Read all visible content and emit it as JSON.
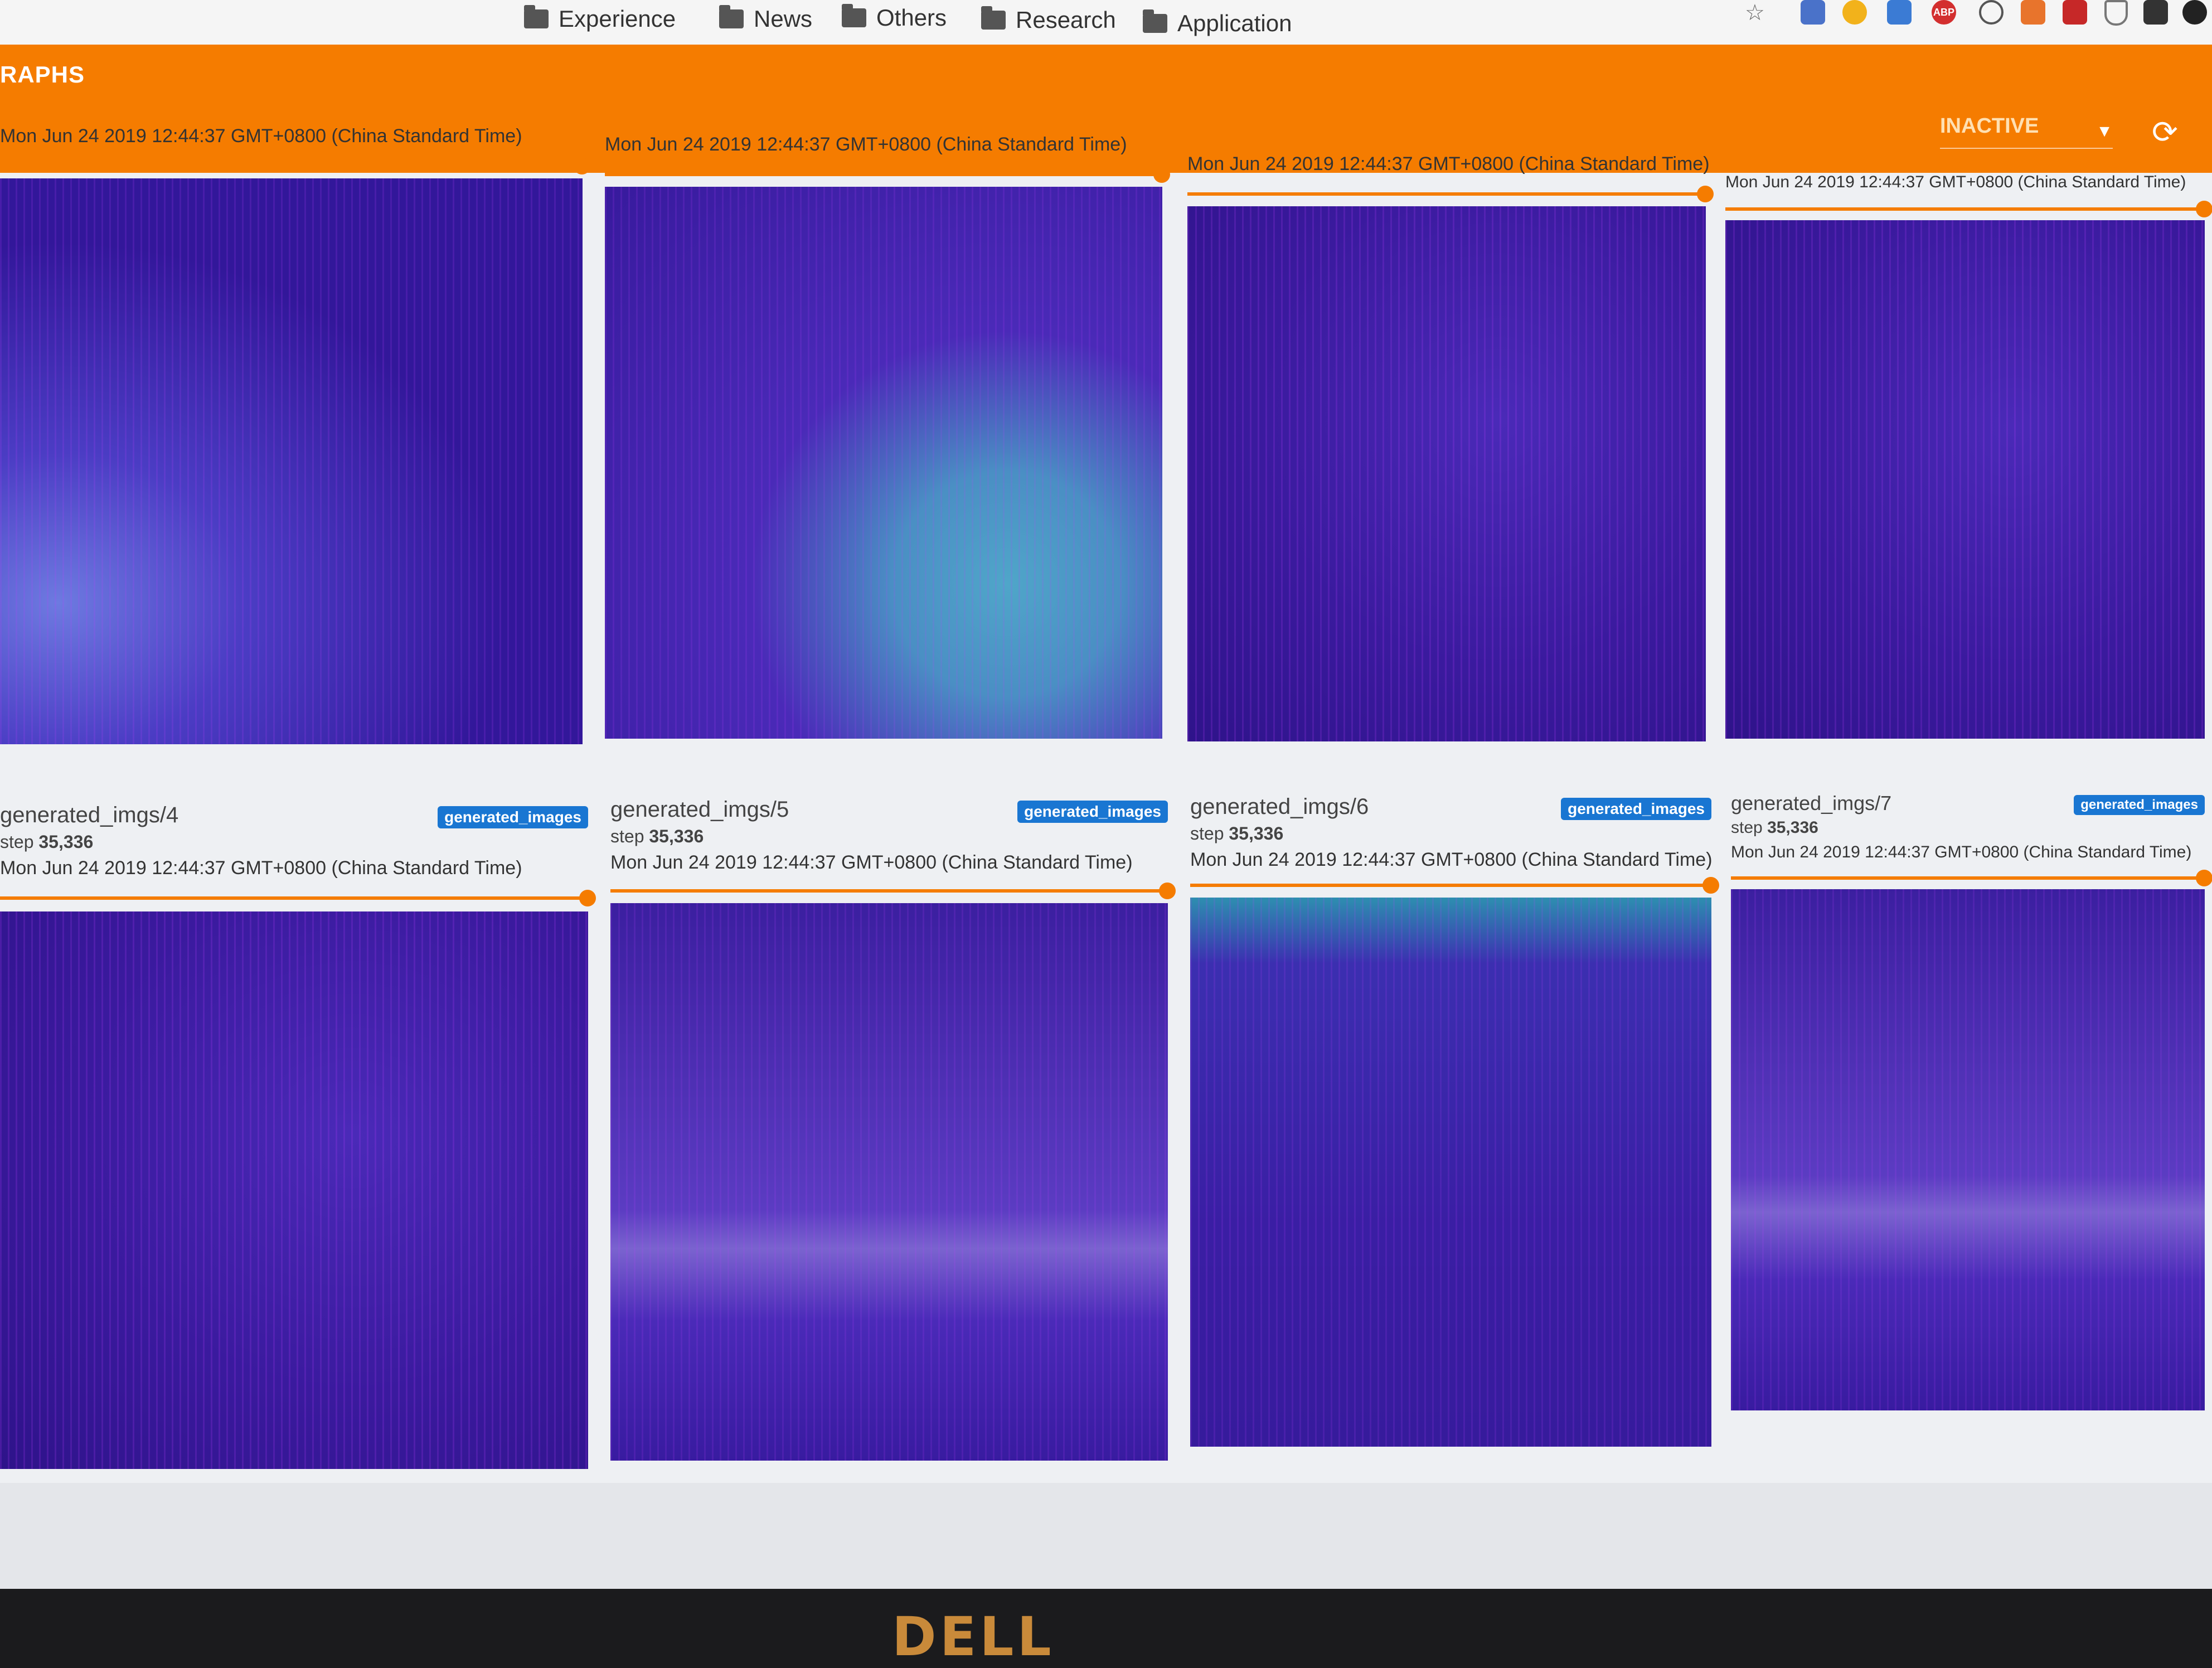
{
  "bookmarks": {
    "items": [
      {
        "label": "Experience",
        "icon": "folder-icon"
      },
      {
        "label": "News",
        "icon": "folder-icon"
      },
      {
        "label": "Others",
        "icon": "folder-icon"
      },
      {
        "label": "Research",
        "icon": "folder-icon"
      },
      {
        "label": "Application",
        "icon": "folder-icon"
      }
    ],
    "extensions": [
      {
        "icon": "star-icon"
      },
      {
        "icon": "extension-blue-icon"
      },
      {
        "icon": "chrome-icon"
      },
      {
        "icon": "dashboard-icon"
      },
      {
        "icon": "adblock-icon",
        "label": "ABP"
      },
      {
        "icon": "speedometer-icon"
      },
      {
        "icon": "fox-icon"
      },
      {
        "icon": "zotero-icon"
      },
      {
        "icon": "shield-icon"
      },
      {
        "icon": "puzzle-icon"
      },
      {
        "icon": "github-icon"
      }
    ]
  },
  "toolbar": {
    "title": "RAPHS",
    "run_select": {
      "value": "INACTIVE"
    },
    "refresh_icon": "refresh-icon",
    "color": "#f57c00"
  },
  "cards_top": [
    {
      "timestamp": "Mon Jun 24 2019 12:44:37 GMT+0800 (China Standard Time)"
    },
    {
      "timestamp": "Mon Jun 24 2019 12:44:37 GMT+0800 (China Standard Time)"
    },
    {
      "timestamp": "Mon Jun 24 2019 12:44:37 GMT+0800 (China Standard Time)"
    },
    {
      "timestamp": "Mon Jun 24 2019 12:44:37 GMT+0800 (China Standard Time)"
    }
  ],
  "cards_bottom": [
    {
      "name": "generated_imgs/4",
      "step_label": "step",
      "step": "35,336",
      "tag": "generated_images",
      "timestamp": "Mon Jun 24 2019 12:44:37 GMT+0800 (China Standard Time)"
    },
    {
      "name": "generated_imgs/5",
      "step_label": "step",
      "step": "35,336",
      "tag": "generated_images",
      "timestamp": "Mon Jun 24 2019 12:44:37 GMT+0800 (China Standard Time)"
    },
    {
      "name": "generated_imgs/6",
      "step_label": "step",
      "step": "35,336",
      "tag": "generated_images",
      "timestamp": "Mon Jun 24 2019 12:44:37 GMT+0800 (China Standard Time)"
    },
    {
      "name": "generated_imgs/7",
      "step_label": "step",
      "step": "35,336",
      "tag": "generated_images",
      "timestamp": "Mon Jun 24 2019 12:44:37 GMT+0800 (China Standard Time)"
    }
  ],
  "monitor": {
    "brand": "DELL"
  }
}
